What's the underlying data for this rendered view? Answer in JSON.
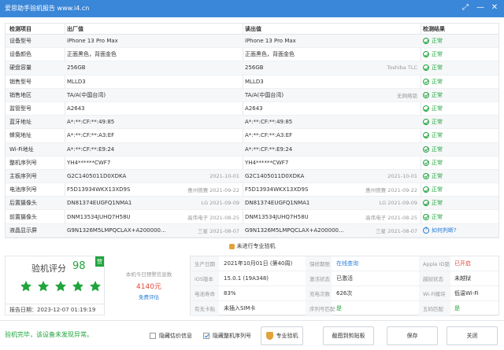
{
  "window": {
    "title": "爱思助手验机报告 www.i4.cn",
    "buttons": {
      "share": "⤢",
      "minimize": "—",
      "close": "✕"
    }
  },
  "table": {
    "headers": {
      "item": "检测项目",
      "factory": "出厂值",
      "read": "读出值",
      "result": "检测结果"
    },
    "rows": [
      {
        "item": "设备型号",
        "factory": "iPhone 13 Pro Max",
        "factory_note": "",
        "read": "iPhone 13 Pro Max",
        "read_note": "",
        "result": "正常",
        "result_type": "ok"
      },
      {
        "item": "设备颜色",
        "factory": "正面黑色，背面金色",
        "factory_note": "",
        "read": "正面黑色，背面金色",
        "read_note": "",
        "result": "正常",
        "result_type": "ok"
      },
      {
        "item": "硬盘容量",
        "factory": "256GB",
        "factory_note": "",
        "read": "256GB",
        "read_note": "Toshiba TLC",
        "result": "正常",
        "result_type": "ok"
      },
      {
        "item": "销售型号",
        "factory": "MLLD3",
        "factory_note": "",
        "read": "MLLD3",
        "read_note": "",
        "result": "正常",
        "result_type": "ok"
      },
      {
        "item": "销售地区",
        "factory": "TA/A(中国台湾)",
        "factory_note": "",
        "read": "TA/A(中国台湾)",
        "read_note": "无网络锁",
        "result": "正常",
        "result_type": "ok"
      },
      {
        "item": "监管型号",
        "factory": "A2643",
        "factory_note": "",
        "read": "A2643",
        "read_note": "",
        "result": "正常",
        "result_type": "ok"
      },
      {
        "item": "蓝牙地址",
        "factory": "A*:**:CF:**:49:85",
        "factory_note": "",
        "read": "A*:**:CF:**:49:85",
        "read_note": "",
        "result": "正常",
        "result_type": "ok"
      },
      {
        "item": "蜂窝地址",
        "factory": "A*:**:CF:**:A3:EF",
        "factory_note": "",
        "read": "A*:**:CF:**:A3:EF",
        "read_note": "",
        "result": "正常",
        "result_type": "ok"
      },
      {
        "item": "Wi-Fi地址",
        "factory": "A*:**:CF:**:E9:24",
        "factory_note": "",
        "read": "A*:**:CF:**:E9:24",
        "read_note": "",
        "result": "正常",
        "result_type": "ok"
      },
      {
        "item": "整机序列号",
        "factory": "YH4******CWF7",
        "factory_note": "",
        "read": "YH4******CWF7",
        "read_note": "",
        "result": "正常",
        "result_type": "ok"
      },
      {
        "item": "主板序列号",
        "factory": "G2C1405011D0XDKA",
        "factory_note": "2021-10-01",
        "read": "G2C1405011D0XDKA",
        "read_note": "2021-10-01",
        "result": "正常",
        "result_type": "ok"
      },
      {
        "item": "电池序列号",
        "factory": "F5D13934WKX13XD9S",
        "factory_note": "惠州德赛 2021-09-22",
        "read": "F5D13934WKX13XD9S",
        "read_note": "惠州德赛 2021-09-22",
        "result": "正常",
        "result_type": "ok"
      },
      {
        "item": "后置摄像头",
        "factory": "DN81374EUGFQ1NMA1",
        "factory_note": "LG 2021-09-09",
        "read": "DN81374EUGFQ1NMA1",
        "read_note": "LG 2021-09-09",
        "result": "正常",
        "result_type": "ok"
      },
      {
        "item": "前置摄像头",
        "factory": "DNM13534JUHQ7H58U",
        "factory_note": "高伟电子 2021-08-25",
        "read": "DNM13534JUHQ7H58U",
        "read_note": "高伟电子 2021-08-25",
        "result": "正常",
        "result_type": "ok"
      },
      {
        "item": "液晶显示屏",
        "factory": "G9N1326M5LMPQCLAX+A200000...",
        "factory_note": "三星 2021-08-07",
        "read": "G9N1326M5LMPQCLAX+A200000...",
        "read_note": "三星 2021-08-07",
        "result": "如何判断?",
        "result_type": "link"
      }
    ]
  },
  "pro_check": {
    "label": "未进行专业验机"
  },
  "score": {
    "label": "验机评分",
    "value": "98",
    "badge": "赞",
    "stars": 5,
    "report_date_label": "报告日期：",
    "report_date": "2023-12-07 01:19:19"
  },
  "today_count": {
    "label": "本机今日预警信息数",
    "value": "4140元",
    "link": "免费评估"
  },
  "info": {
    "rows": [
      [
        {
          "label": "生产日期",
          "value": "2021年10月01日 (第40周)",
          "style": ""
        },
        {
          "label": "保修期限",
          "value": "在线查询",
          "style": "blue"
        },
        {
          "label": "Apple ID锁",
          "value": "已开启",
          "style": "red"
        }
      ],
      [
        {
          "label": "iOS版本",
          "value": "15.0.1 (19A348)",
          "style": ""
        },
        {
          "label": "激活状态",
          "value": "已激活",
          "style": ""
        },
        {
          "label": "越狱状态",
          "value": "未越狱",
          "style": ""
        }
      ],
      [
        {
          "label": "电池寿命",
          "value": "83%",
          "style": ""
        },
        {
          "label": "充电次数",
          "value": "626次",
          "style": ""
        },
        {
          "label": "Wi-Fi模块",
          "value": "低温Wi-Fi",
          "style": ""
        }
      ],
      [
        {
          "label": "有无卡贴",
          "value": "未插入SIM卡",
          "style": ""
        },
        {
          "label": "序列号匹配",
          "value": "是",
          "style": "green"
        },
        {
          "label": "五码匹配",
          "value": "是",
          "style": "green"
        }
      ]
    ]
  },
  "footer": {
    "verdict": "验机完毕，该设备未发现异常。",
    "hide_valuation": "隐藏估价信息",
    "hide_serial": "隐藏整机序列号",
    "hide_valuation_checked": false,
    "hide_serial_checked": true,
    "pro_button": "专业验机",
    "copy_button": "截图到剪贴板",
    "save_button": "保存",
    "close_button": "关闭"
  },
  "colors": {
    "titlebar": "#3a86d8",
    "ok": "#20a43c",
    "link": "#2a7fd8",
    "warn": "#e04a3a",
    "accent": "#e2a23a"
  }
}
